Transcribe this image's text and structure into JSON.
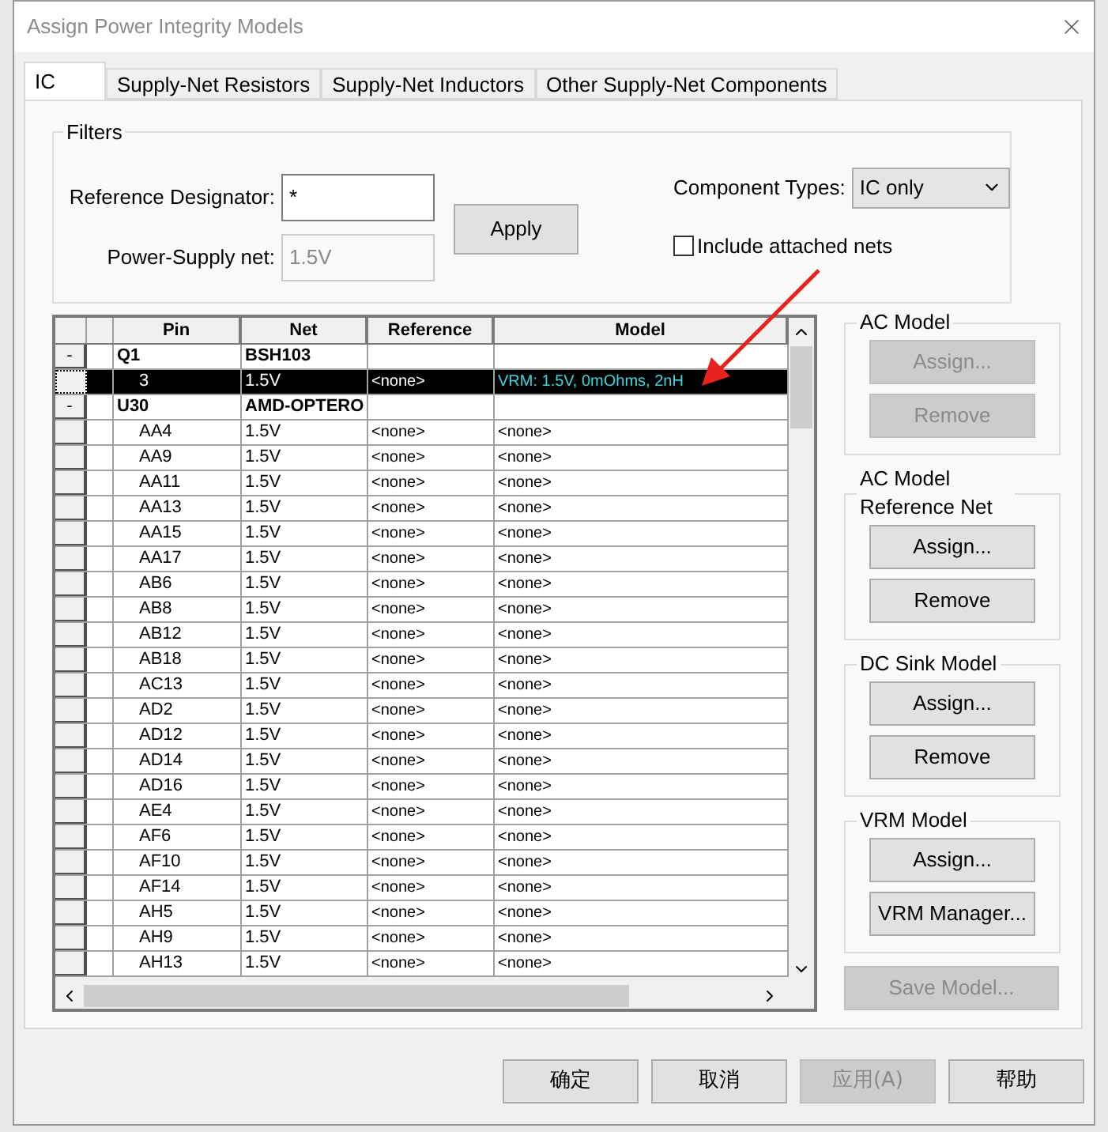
{
  "window": {
    "title": "Assign Power Integrity Models"
  },
  "tabs": [
    {
      "label": "IC",
      "selected": true
    },
    {
      "label": "Supply-Net Resistors",
      "selected": false
    },
    {
      "label": "Supply-Net Inductors",
      "selected": false
    },
    {
      "label": "Other Supply-Net Components",
      "selected": false
    }
  ],
  "filters": {
    "title": "Filters",
    "reference_designator": {
      "label": "Reference Designator:",
      "value": "*"
    },
    "power_supply_net": {
      "label": "Power-Supply net:",
      "value": "1.5V",
      "disabled": true
    },
    "apply_button": "Apply",
    "component_types": {
      "label": "Component Types:",
      "value": "IC only"
    },
    "include_attached_nets": {
      "label": "Include attached nets",
      "checked": false
    }
  },
  "table": {
    "columns": [
      "Pin",
      "Net",
      "Reference",
      "Model"
    ],
    "rows": [
      {
        "kind": "group",
        "toggle": "-",
        "pin": "Q1",
        "net": "BSH103",
        "reference": "",
        "model": "",
        "selected": false
      },
      {
        "kind": "pin",
        "pin": "3",
        "net": "1.5V",
        "reference": "<none>",
        "model": "VRM: 1.5V, 0mOhms, 2nH",
        "selected": true
      },
      {
        "kind": "group",
        "toggle": "-",
        "pin": "U30",
        "net": "AMD-OPTERO",
        "reference": "",
        "model": "",
        "selected": false
      },
      {
        "kind": "pin",
        "pin": "AA4",
        "net": "1.5V",
        "reference": "<none>",
        "model": "<none>",
        "selected": false
      },
      {
        "kind": "pin",
        "pin": "AA9",
        "net": "1.5V",
        "reference": "<none>",
        "model": "<none>",
        "selected": false
      },
      {
        "kind": "pin",
        "pin": "AA11",
        "net": "1.5V",
        "reference": "<none>",
        "model": "<none>",
        "selected": false
      },
      {
        "kind": "pin",
        "pin": "AA13",
        "net": "1.5V",
        "reference": "<none>",
        "model": "<none>",
        "selected": false
      },
      {
        "kind": "pin",
        "pin": "AA15",
        "net": "1.5V",
        "reference": "<none>",
        "model": "<none>",
        "selected": false
      },
      {
        "kind": "pin",
        "pin": "AA17",
        "net": "1.5V",
        "reference": "<none>",
        "model": "<none>",
        "selected": false
      },
      {
        "kind": "pin",
        "pin": "AB6",
        "net": "1.5V",
        "reference": "<none>",
        "model": "<none>",
        "selected": false
      },
      {
        "kind": "pin",
        "pin": "AB8",
        "net": "1.5V",
        "reference": "<none>",
        "model": "<none>",
        "selected": false
      },
      {
        "kind": "pin",
        "pin": "AB12",
        "net": "1.5V",
        "reference": "<none>",
        "model": "<none>",
        "selected": false
      },
      {
        "kind": "pin",
        "pin": "AB18",
        "net": "1.5V",
        "reference": "<none>",
        "model": "<none>",
        "selected": false
      },
      {
        "kind": "pin",
        "pin": "AC13",
        "net": "1.5V",
        "reference": "<none>",
        "model": "<none>",
        "selected": false
      },
      {
        "kind": "pin",
        "pin": "AD2",
        "net": "1.5V",
        "reference": "<none>",
        "model": "<none>",
        "selected": false
      },
      {
        "kind": "pin",
        "pin": "AD12",
        "net": "1.5V",
        "reference": "<none>",
        "model": "<none>",
        "selected": false
      },
      {
        "kind": "pin",
        "pin": "AD14",
        "net": "1.5V",
        "reference": "<none>",
        "model": "<none>",
        "selected": false
      },
      {
        "kind": "pin",
        "pin": "AD16",
        "net": "1.5V",
        "reference": "<none>",
        "model": "<none>",
        "selected": false
      },
      {
        "kind": "pin",
        "pin": "AE4",
        "net": "1.5V",
        "reference": "<none>",
        "model": "<none>",
        "selected": false
      },
      {
        "kind": "pin",
        "pin": "AF6",
        "net": "1.5V",
        "reference": "<none>",
        "model": "<none>",
        "selected": false
      },
      {
        "kind": "pin",
        "pin": "AF10",
        "net": "1.5V",
        "reference": "<none>",
        "model": "<none>",
        "selected": false
      },
      {
        "kind": "pin",
        "pin": "AF14",
        "net": "1.5V",
        "reference": "<none>",
        "model": "<none>",
        "selected": false
      },
      {
        "kind": "pin",
        "pin": "AH5",
        "net": "1.5V",
        "reference": "<none>",
        "model": "<none>",
        "selected": false
      },
      {
        "kind": "pin",
        "pin": "AH9",
        "net": "1.5V",
        "reference": "<none>",
        "model": "<none>",
        "selected": false
      },
      {
        "kind": "pin",
        "pin": "AH13",
        "net": "1.5V",
        "reference": "<none>",
        "model": "<none>",
        "selected": false
      }
    ]
  },
  "model_groups": [
    {
      "title": "AC Model",
      "buttons": [
        {
          "label": "Assign...",
          "disabled": true
        },
        {
          "label": "Remove",
          "disabled": true
        }
      ]
    },
    {
      "title": "AC Model Reference Net",
      "buttons": [
        {
          "label": "Assign...",
          "disabled": false
        },
        {
          "label": "Remove",
          "disabled": false
        }
      ]
    },
    {
      "title": "DC Sink Model",
      "buttons": [
        {
          "label": "Assign...",
          "disabled": false
        },
        {
          "label": "Remove",
          "disabled": false
        }
      ]
    },
    {
      "title": "VRM Model",
      "buttons": [
        {
          "label": "Assign...",
          "disabled": false
        },
        {
          "label": "VRM Manager...",
          "disabled": false
        }
      ]
    }
  ],
  "save_model_button": {
    "label": "Save Model...",
    "disabled": true
  },
  "dialog_buttons": [
    {
      "label": "确定",
      "disabled": false
    },
    {
      "label": "取消",
      "disabled": false
    },
    {
      "label": "应用(A)",
      "disabled": true
    },
    {
      "label": "帮助",
      "disabled": false
    }
  ]
}
